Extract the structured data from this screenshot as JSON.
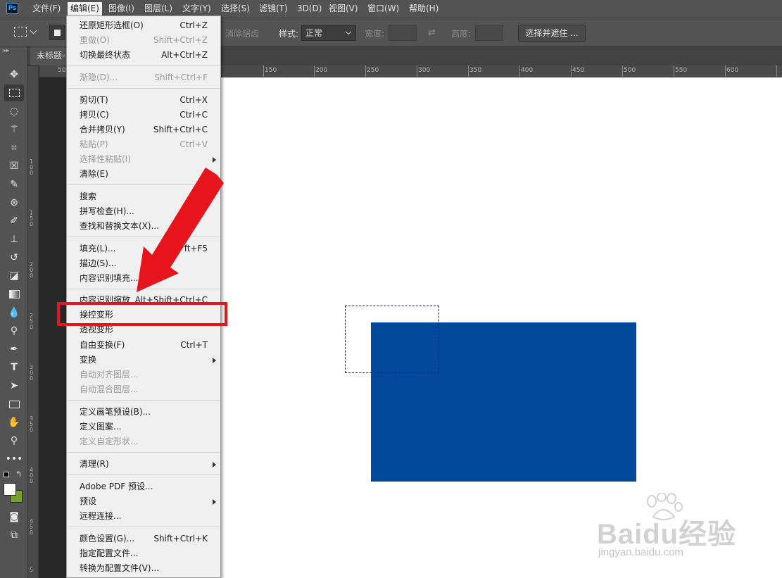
{
  "app": {
    "logo": "Ps"
  },
  "menubar": {
    "items": [
      {
        "label": "文件(F)"
      },
      {
        "label": "编辑(E)"
      },
      {
        "label": "图像(I)"
      },
      {
        "label": "图层(L)"
      },
      {
        "label": "文字(Y)"
      },
      {
        "label": "选择(S)"
      },
      {
        "label": "滤镜(T)"
      },
      {
        "label": "3D(D)"
      },
      {
        "label": "视图(V)"
      },
      {
        "label": "窗口(W)"
      },
      {
        "label": "帮助(H)"
      }
    ]
  },
  "options": {
    "antialias": "消除锯齿",
    "style_label": "样式:",
    "style_value": "正常",
    "width_label": "宽度:",
    "height_label": "高度:",
    "select_mask": "选择并遮住 ..."
  },
  "document": {
    "tab_label": "未标题-"
  },
  "rulers": {
    "h_ticks": [
      "50",
      "150",
      "200",
      "250",
      "300",
      "350",
      "400",
      "450",
      "500",
      "550",
      "600"
    ],
    "v_ticks": [
      "1 0 0",
      "1 5 0",
      "2 0 0",
      "2 5 0",
      "3 0 0",
      "3 5 0",
      "4 0 0",
      "4 5 0",
      "5"
    ]
  },
  "edit_menu": {
    "items": [
      {
        "label": "还原矩形选框(O)",
        "shortcut": "Ctrl+Z",
        "disabled": false
      },
      {
        "label": "重做(O)",
        "shortcut": "Shift+Ctrl+Z",
        "disabled": true
      },
      {
        "label": "切换最终状态",
        "shortcut": "Alt+Ctrl+Z",
        "disabled": false
      },
      {
        "label": "渐隐(D)...",
        "shortcut": "Shift+Ctrl+F",
        "disabled": true
      },
      {
        "label": "剪切(T)",
        "shortcut": "Ctrl+X",
        "disabled": false
      },
      {
        "label": "拷贝(C)",
        "shortcut": "Ctrl+C",
        "disabled": false
      },
      {
        "label": "合并拷贝(Y)",
        "shortcut": "Shift+Ctrl+C",
        "disabled": false
      },
      {
        "label": "粘贴(P)",
        "shortcut": "Ctrl+V",
        "disabled": true
      },
      {
        "label": "选择性粘贴(I)",
        "shortcut": "",
        "disabled": true,
        "submenu": true
      },
      {
        "label": "清除(E)",
        "shortcut": "",
        "disabled": false
      },
      {
        "label": "搜索",
        "shortcut": "C",
        "disabled": false
      },
      {
        "label": "拼写检查(H)...",
        "shortcut": "",
        "disabled": false
      },
      {
        "label": "查找和替换文本(X)...",
        "shortcut": "",
        "disabled": false
      },
      {
        "label": "填充(L)...",
        "shortcut": "ft+F5",
        "disabled": false
      },
      {
        "label": "描边(S)...",
        "shortcut": "",
        "disabled": false
      },
      {
        "label": "内容识别填充...",
        "shortcut": "",
        "disabled": false
      },
      {
        "label": "内容识别缩放",
        "shortcut": "Alt+Shift+Ctrl+C",
        "disabled": false
      },
      {
        "label": "操控变形",
        "shortcut": "",
        "disabled": false
      },
      {
        "label": "透视变形",
        "shortcut": "",
        "disabled": false
      },
      {
        "label": "自由变换(F)",
        "shortcut": "Ctrl+T",
        "disabled": false
      },
      {
        "label": "变换",
        "shortcut": "",
        "disabled": false,
        "submenu": true
      },
      {
        "label": "自动对齐图层...",
        "shortcut": "",
        "disabled": true
      },
      {
        "label": "自动混合图层...",
        "shortcut": "",
        "disabled": true
      },
      {
        "label": "定义画笔预设(B)...",
        "shortcut": "",
        "disabled": false
      },
      {
        "label": "定义图案...",
        "shortcut": "",
        "disabled": false
      },
      {
        "label": "定义自定形状...",
        "shortcut": "",
        "disabled": true
      },
      {
        "label": "清理(R)",
        "shortcut": "",
        "disabled": false,
        "submenu": true
      },
      {
        "label": "Adobe PDF 预设...",
        "shortcut": "",
        "disabled": false
      },
      {
        "label": "预设",
        "shortcut": "",
        "disabled": false,
        "submenu": true
      },
      {
        "label": "远程连接...",
        "shortcut": "",
        "disabled": false
      },
      {
        "label": "颜色设置(G)...",
        "shortcut": "Shift+Ctrl+K",
        "disabled": false
      },
      {
        "label": "指定配置文件...",
        "shortcut": "",
        "disabled": false
      },
      {
        "label": "转换为配置文件(V)...",
        "shortcut": "",
        "disabled": false
      }
    ]
  },
  "colors": {
    "accent_red": "#e8141b",
    "shape_blue": "#02489a"
  },
  "watermark": {
    "brand": "Baidu经验",
    "url": "jingyan.baidu.com"
  }
}
